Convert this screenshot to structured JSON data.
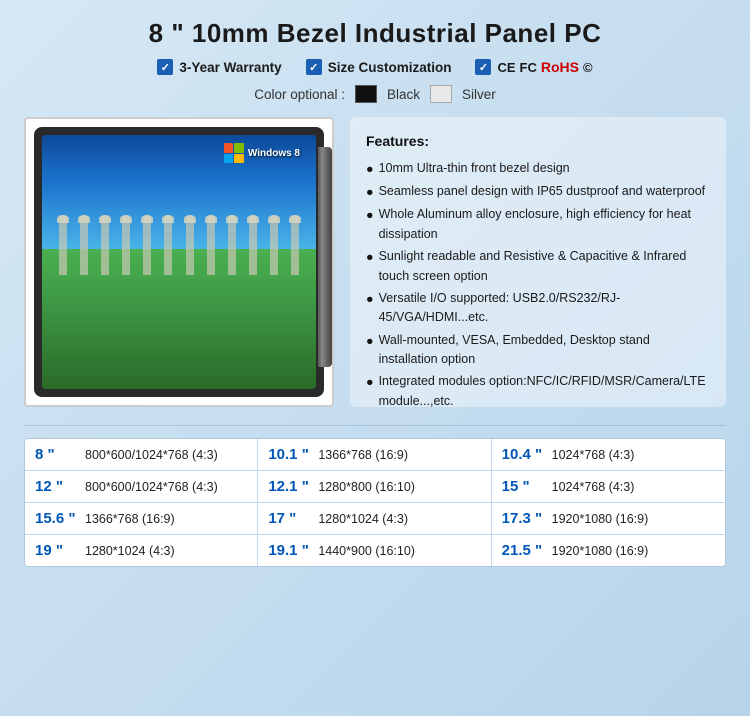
{
  "title": "8 \" 10mm Bezel Industrial Panel PC",
  "badges": [
    {
      "label": "3-Year Warranty"
    },
    {
      "label": "Size Customization"
    },
    {
      "label": "CE FC RoHS"
    }
  ],
  "color_optional_label": "Color optional :",
  "colors": [
    {
      "name": "Black"
    },
    {
      "name": "Silver"
    }
  ],
  "product": {
    "windows_label": "Windows 8"
  },
  "features": {
    "title": "Features:",
    "items": [
      "10mm Ultra-thin front bezel design",
      "Seamless panel design with IP65 dustproof and waterproof",
      "Whole Aluminum alloy enclosure, high efficiency for heat dissipation",
      "Sunlight readable and Resistive & Capacitive & Infrared touch screen option",
      "Versatile I/O supported: USB2.0/RS232/RJ-45/VGA/HDMI...etc.",
      "Wall-mounted, VESA, Embedded, Desktop stand installation option",
      "Integrated modules option:NFC/IC/RFID/MSR/Camera/LTE module...,etc."
    ]
  },
  "specs": [
    {
      "size": "8 \"",
      "resolution": "800*600/1024*768  (4:3)"
    },
    {
      "size": "10.1 \"",
      "resolution": "1366*768  (16:9)"
    },
    {
      "size": "10.4 \"",
      "resolution": "1024*768  (4:3)"
    },
    {
      "size": "12 \"",
      "resolution": "800*600/1024*768  (4:3)"
    },
    {
      "size": "12.1 \"",
      "resolution": "1280*800  (16:10)"
    },
    {
      "size": "15 \"",
      "resolution": "1024*768  (4:3)"
    },
    {
      "size": "15.6 \"",
      "resolution": "1366*768  (16:9)"
    },
    {
      "size": "17 \"",
      "resolution": "1280*1024  (4:3)"
    },
    {
      "size": "17.3 \"",
      "resolution": "1920*1080  (16:9)"
    },
    {
      "size": "19 \"",
      "resolution": "1280*1024  (4:3)"
    },
    {
      "size": "19.1 \"",
      "resolution": "1440*900  (16:10)"
    },
    {
      "size": "21.5 \"",
      "resolution": "1920*1080  (16:9)"
    }
  ]
}
